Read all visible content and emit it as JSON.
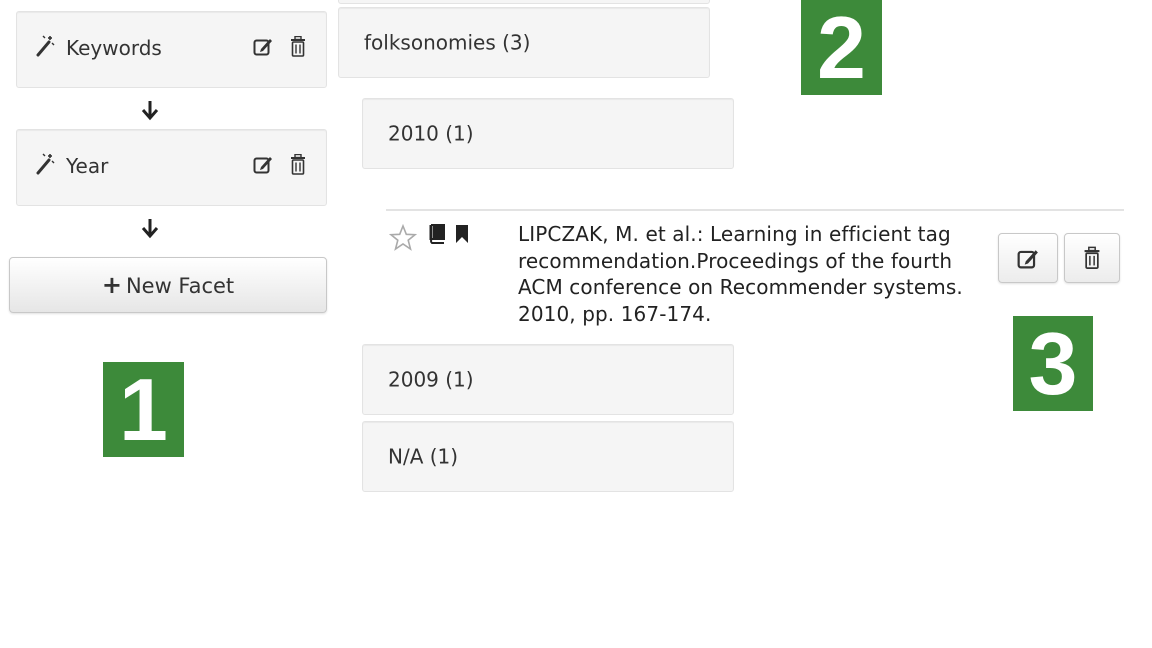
{
  "facets": [
    {
      "label": "Keywords",
      "icon": "magic-wand-icon"
    },
    {
      "label": "Year",
      "icon": "magic-wand-icon"
    }
  ],
  "new_facet_button": {
    "label": "New Facet",
    "icon": "plus-icon"
  },
  "values": {
    "folksonomies": "folksonomies (3)",
    "y2010": "2010 (1)",
    "y2009": "2009 (1)",
    "na": "N/A (1)"
  },
  "publication": {
    "lines": [
      "LIPCZAK, M. et al.: Learning in efficient tag",
      "recommendation.Proceedings of the fourth",
      "ACM conference on Recommender systems.",
      "2010, pp. 167-174."
    ],
    "icons": [
      "star-icon",
      "book-icon",
      "bookmark-icon"
    ]
  },
  "callouts": [
    "1",
    "2",
    "3"
  ],
  "colors": {
    "callout_green": "#3d8a3a",
    "panel_bg": "#f5f5f5"
  }
}
